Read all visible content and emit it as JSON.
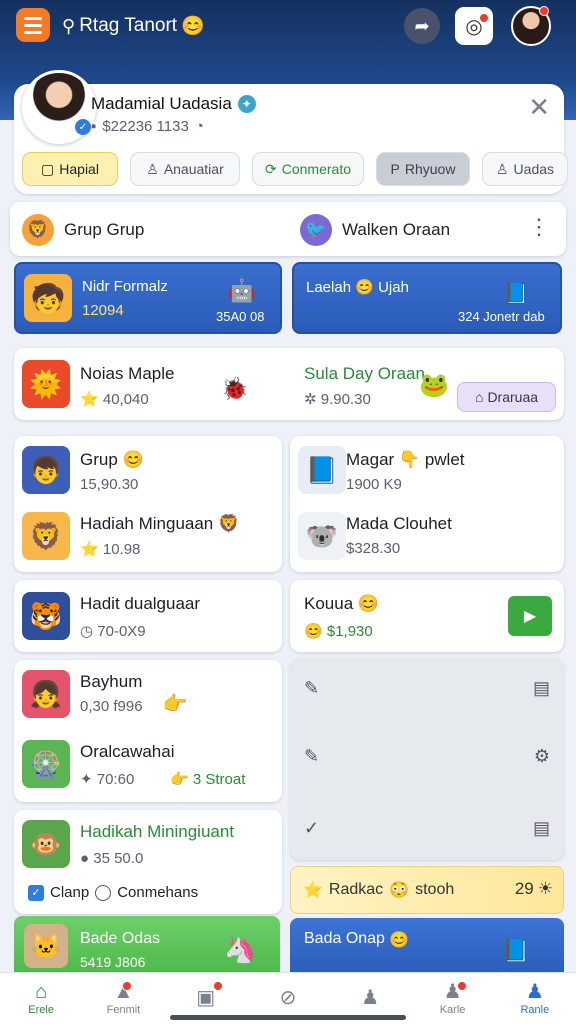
{
  "header": {
    "title": "Rtag Tanort",
    "emoji": "😊"
  },
  "profile": {
    "name": "Madamial Uadasia",
    "balance": "$22236 1133",
    "tabs": [
      {
        "label": "Hapial",
        "icon": "▢"
      },
      {
        "label": "Anauatiar",
        "icon": "♙"
      },
      {
        "label": "Conmerato",
        "icon": "⟳"
      },
      {
        "label": "Rhyuow",
        "icon": "P"
      },
      {
        "label": "Uadas",
        "icon": "♙"
      }
    ]
  },
  "groups": {
    "left": "Grup Grup",
    "right": "Walken Oraan"
  },
  "promo": {
    "left": {
      "title": "Nidr Formalz",
      "value": "12094",
      "small": "35A0 08"
    },
    "right": {
      "title": "Laelah",
      "title2": "Ujah",
      "small": "324 Jonetr dab"
    }
  },
  "featured": {
    "left": {
      "title": "Noias Maple",
      "value": "40,040"
    },
    "right": {
      "title": "Sula Day Oraan",
      "value": "9.90.30"
    },
    "pill": "Draruaa"
  },
  "items_left": [
    {
      "title": "Grup",
      "value": "15,90.30"
    },
    {
      "title": "Hadiah Minguaan",
      "value": "10.98"
    },
    {
      "title": "Hadit dualguaar",
      "value": "70-0X9"
    },
    {
      "title": "Bayhum",
      "value": "0,30 f996"
    },
    {
      "title": "Oralcawahai",
      "value": "70:60"
    },
    {
      "title": "Hadikah Miningiuant",
      "value": "35 50.0"
    }
  ],
  "items_right": [
    {
      "title": "Magar",
      "title2": "pwlet",
      "value": "1900 K9"
    },
    {
      "title": "Mada Clouhet",
      "value": "$328.30"
    },
    {
      "title": "Kouua",
      "value": "$1,930"
    }
  ],
  "extra": {
    "stroat": "3 Stroat",
    "radio_a": "Clanp",
    "radio_b": "Conmehans"
  },
  "yellow": {
    "label": "Radkac",
    "label2": "stooh",
    "count": "29"
  },
  "green_bottom": {
    "title": "Bade Odas",
    "value": "5419 J806"
  },
  "blue_bottom": {
    "title": "Bada Onap"
  },
  "nav": [
    {
      "label": "Erele",
      "icon": "⌂"
    },
    {
      "label": "Fenmit",
      "icon": "▲"
    },
    {
      "label": "",
      "icon": "▣"
    },
    {
      "label": "",
      "icon": "⊘"
    },
    {
      "label": "",
      "icon": "♟"
    },
    {
      "label": "Karle",
      "icon": "♟"
    },
    {
      "label": "Ranle",
      "icon": "♟"
    }
  ],
  "colors": {
    "accent": "#2a8a37",
    "header": "#1f4a8f",
    "blue_card": "#2a5bb8"
  }
}
